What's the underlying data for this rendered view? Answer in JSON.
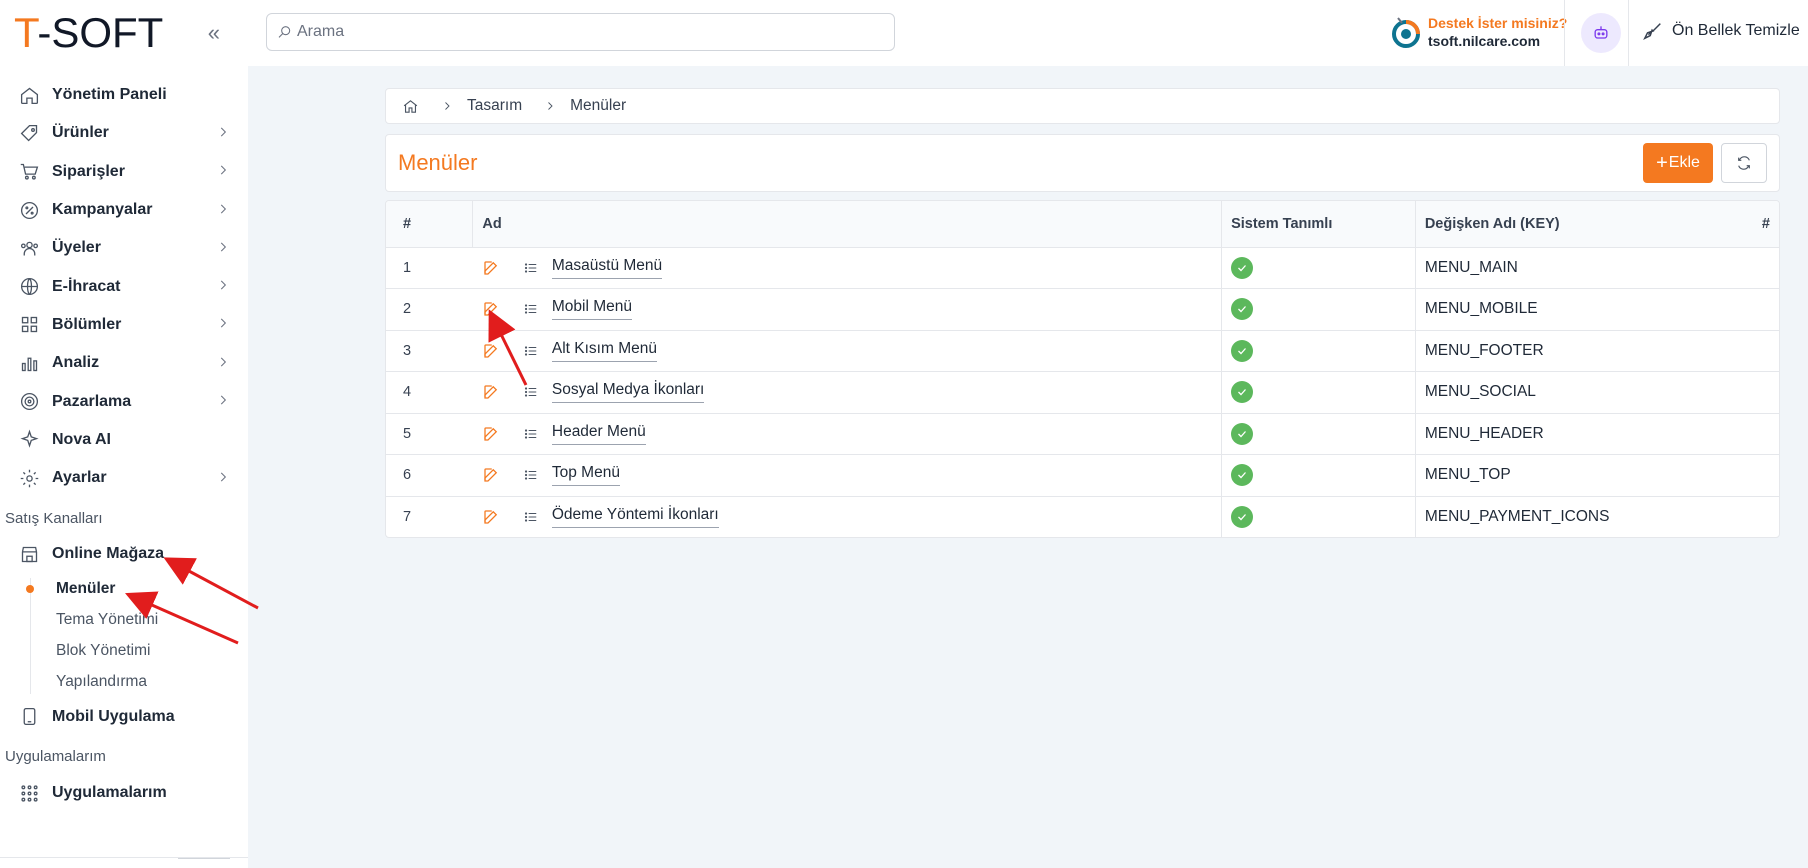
{
  "brand": {
    "logo_t": "T",
    "logo_rest": "-SOFT",
    "accent": "#f47920"
  },
  "sidebar": {
    "items": [
      {
        "label": "Yönetim Paneli",
        "icon": "home-icon",
        "chevron": false
      },
      {
        "label": "Ürünler",
        "icon": "tag-icon",
        "chevron": true
      },
      {
        "label": "Siparişler",
        "icon": "cart-icon",
        "chevron": true
      },
      {
        "label": "Kampanyalar",
        "icon": "discount-icon",
        "chevron": true
      },
      {
        "label": "Üyeler",
        "icon": "users-icon",
        "chevron": true
      },
      {
        "label": "E-İhracat",
        "icon": "globe-icon",
        "chevron": true
      },
      {
        "label": "Bölümler",
        "icon": "grid-icon",
        "chevron": true
      },
      {
        "label": "Analiz",
        "icon": "chart-icon",
        "chevron": true
      },
      {
        "label": "Pazarlama",
        "icon": "target-icon",
        "chevron": true
      },
      {
        "label": "Nova AI",
        "icon": "sparkle-icon",
        "chevron": false
      },
      {
        "label": "Ayarlar",
        "icon": "gear-icon",
        "chevron": true
      }
    ],
    "sales_channels_title": "Satış Kanalları",
    "online_store": {
      "label": "Online Mağaza",
      "icon": "store-icon"
    },
    "online_store_sub": [
      "Menüler",
      "Tema Yönetimi",
      "Blok Yönetimi",
      "Yapılandırma"
    ],
    "mobile_app": {
      "label": "Mobil Uygulama",
      "icon": "mobile-app-icon"
    },
    "apps_title": "Uygulamalarım",
    "apps_item": {
      "label": "Uygulamalarım",
      "icon": "apps-icon"
    }
  },
  "topbar": {
    "search_placeholder": "Arama",
    "support_question": "Destek İster misiniz?",
    "support_domain": "tsoft.nilcare.com",
    "cache_label": "Ön Bellek Temizle"
  },
  "breadcrumb": {
    "items": [
      "Tasarım",
      "Menüler"
    ]
  },
  "page": {
    "title": "Menüler",
    "add_label": "Ekle"
  },
  "table": {
    "headers": {
      "num": "#",
      "name": "Ad",
      "system": "Sistem Tanımlı",
      "key": "Değişken Adı (KEY)",
      "hash": "#"
    },
    "rows": [
      {
        "num": "1",
        "name": "Masaüstü Menü",
        "key": "MENU_MAIN",
        "system": true
      },
      {
        "num": "2",
        "name": "Mobil Menü",
        "key": "MENU_MOBILE",
        "system": true
      },
      {
        "num": "3",
        "name": "Alt Kısım Menü",
        "key": "MENU_FOOTER",
        "system": true
      },
      {
        "num": "4",
        "name": "Sosyal Medya İkonları",
        "key": "MENU_SOCIAL",
        "system": true
      },
      {
        "num": "5",
        "name": "Header Menü",
        "key": "MENU_HEADER",
        "system": true
      },
      {
        "num": "6",
        "name": "Top Menü",
        "key": "MENU_TOP",
        "system": true
      },
      {
        "num": "7",
        "name": "Ödeme Yöntemi İkonları",
        "key": "MENU_PAYMENT_ICONS",
        "system": true
      }
    ]
  },
  "colors": {
    "success": "#5cb85c",
    "annotation_arrow": "#e11d1d"
  }
}
